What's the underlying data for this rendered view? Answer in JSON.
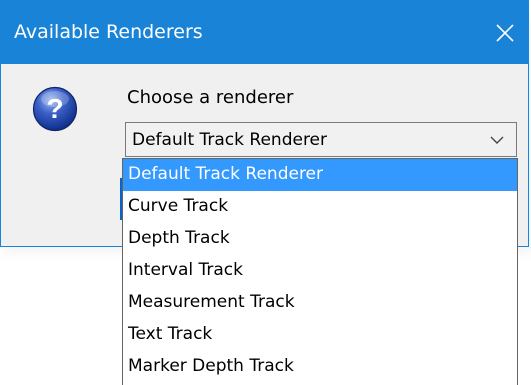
{
  "dialog": {
    "title": "Available Renderers",
    "close_label": "✕",
    "icon": "question-icon",
    "prompt": "Choose a renderer",
    "accent_color": "#1883d7"
  },
  "select": {
    "value": "Default Track Renderer",
    "chevron_icon": "chevron-down-icon"
  },
  "dropdown": {
    "highlight_color": "#3399ff",
    "selected_index": 0,
    "options": [
      {
        "label": "Default Track Renderer"
      },
      {
        "label": "Curve Track"
      },
      {
        "label": "Depth Track"
      },
      {
        "label": "Interval Track"
      },
      {
        "label": "Measurement Track"
      },
      {
        "label": "Text Track"
      },
      {
        "label": "Marker Depth Track"
      }
    ]
  }
}
